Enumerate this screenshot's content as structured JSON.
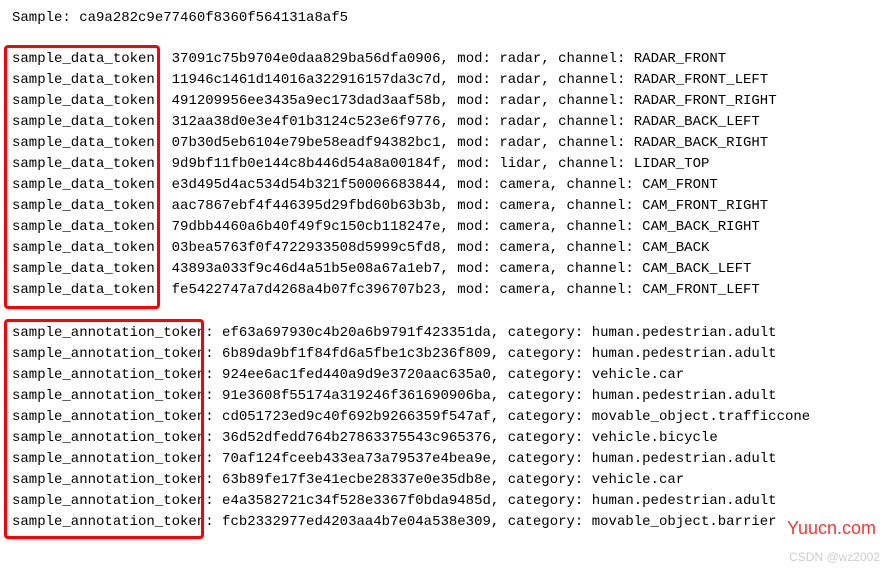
{
  "header": {
    "label": "Sample:",
    "token": "ca9a282c9e77460f8360f564131a8af5"
  },
  "sample_data": {
    "key_label": "sample_data_token:",
    "mod_label": "mod:",
    "channel_label": "channel:",
    "rows": [
      {
        "token": "37091c75b9704e0daa829ba56dfa0906",
        "mod": "radar",
        "channel": "RADAR_FRONT"
      },
      {
        "token": "11946c1461d14016a322916157da3c7d",
        "mod": "radar",
        "channel": "RADAR_FRONT_LEFT"
      },
      {
        "token": "491209956ee3435a9ec173dad3aaf58b",
        "mod": "radar",
        "channel": "RADAR_FRONT_RIGHT"
      },
      {
        "token": "312aa38d0e3e4f01b3124c523e6f9776",
        "mod": "radar",
        "channel": "RADAR_BACK_LEFT"
      },
      {
        "token": "07b30d5eb6104e79be58eadf94382bc1",
        "mod": "radar",
        "channel": "RADAR_BACK_RIGHT"
      },
      {
        "token": "9d9bf11fb0e144c8b446d54a8a00184f",
        "mod": "lidar",
        "channel": "LIDAR_TOP"
      },
      {
        "token": "e3d495d4ac534d54b321f50006683844",
        "mod": "camera",
        "channel": "CAM_FRONT"
      },
      {
        "token": "aac7867ebf4f446395d29fbd60b63b3b",
        "mod": "camera",
        "channel": "CAM_FRONT_RIGHT"
      },
      {
        "token": "79dbb4460a6b40f49f9c150cb118247e",
        "mod": "camera",
        "channel": "CAM_BACK_RIGHT"
      },
      {
        "token": "03bea5763f0f4722933508d5999c5fd8",
        "mod": "camera",
        "channel": "CAM_BACK"
      },
      {
        "token": "43893a033f9c46d4a51b5e08a67a1eb7",
        "mod": "camera",
        "channel": "CAM_BACK_LEFT"
      },
      {
        "token": "fe5422747a7d4268a4b07fc396707b23",
        "mod": "camera",
        "channel": "CAM_FRONT_LEFT"
      }
    ]
  },
  "sample_annotation": {
    "key_label": "sample_annotation_token:",
    "category_label": "category:",
    "rows": [
      {
        "token": "ef63a697930c4b20a6b9791f423351da",
        "category": "human.pedestrian.adult"
      },
      {
        "token": "6b89da9bf1f84fd6a5fbe1c3b236f809",
        "category": "human.pedestrian.adult"
      },
      {
        "token": "924ee6ac1fed440a9d9e3720aac635a0",
        "category": "vehicle.car"
      },
      {
        "token": "91e3608f55174a319246f361690906ba",
        "category": "human.pedestrian.adult"
      },
      {
        "token": "cd051723ed9c40f692b9266359f547af",
        "category": "movable_object.trafficcone"
      },
      {
        "token": "36d52dfedd764b27863375543c965376",
        "category": "vehicle.bicycle"
      },
      {
        "token": "70af124fceeb433ea73a79537e4bea9e",
        "category": "human.pedestrian.adult"
      },
      {
        "token": "63b89fe17f3e41ecbe28337e0e35db8e",
        "category": "vehicle.car"
      },
      {
        "token": "e4a3582721c34f528e3367f0bda9485d",
        "category": "human.pedestrian.adult"
      },
      {
        "token": "fcb2332977ed4203aa4b7e04a538e309",
        "category": "movable_object.barrier"
      }
    ]
  },
  "watermarks": {
    "site": "Yuucn.com",
    "credit": "CSDN @wz2002"
  }
}
